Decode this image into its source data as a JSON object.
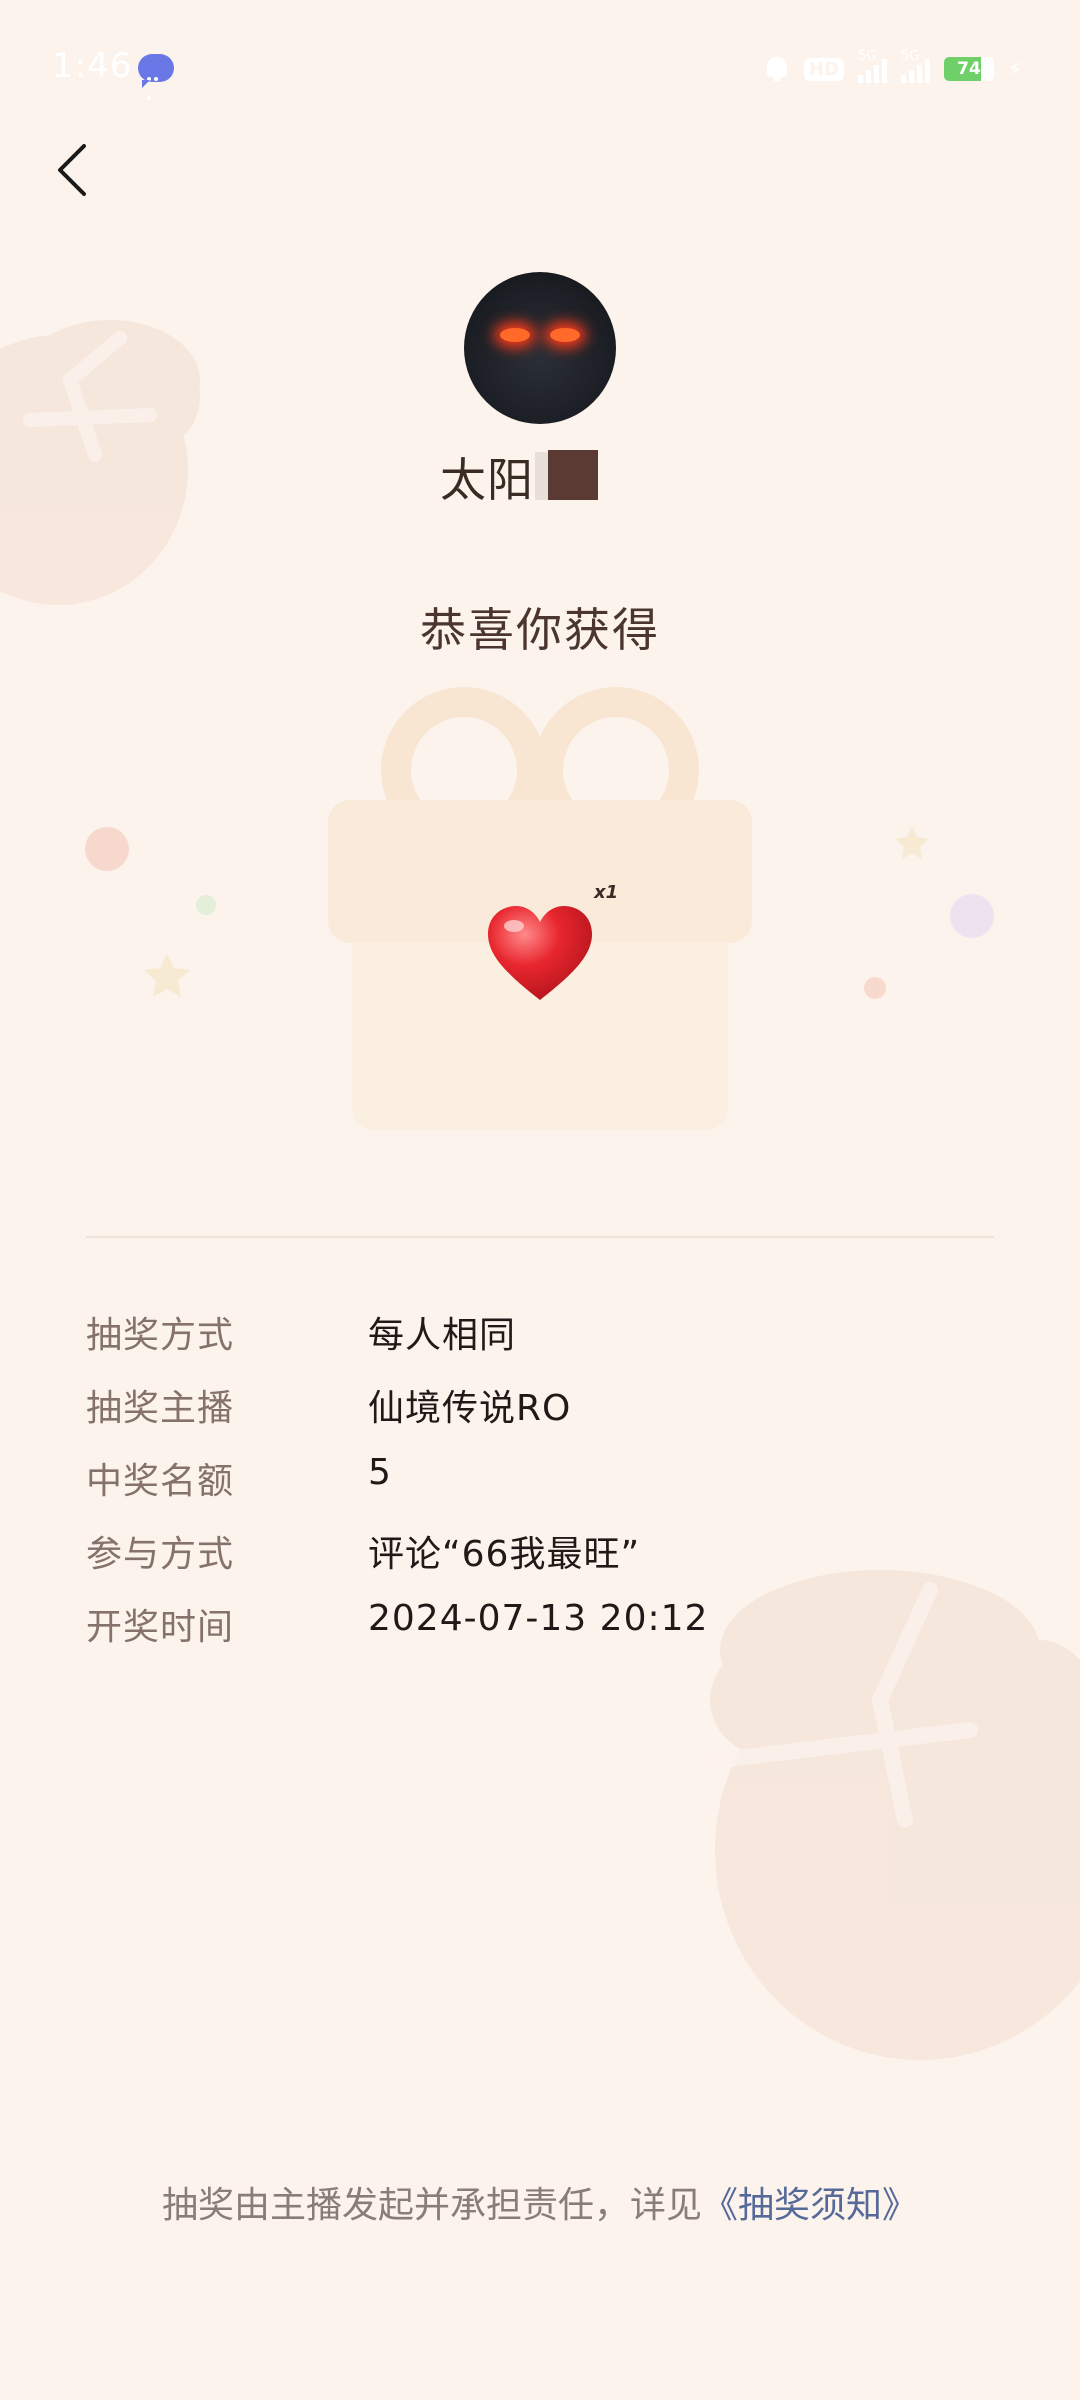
{
  "status_bar": {
    "time": "1:46",
    "hd_label": "HD",
    "network_1": "5G",
    "network_2": "5G",
    "battery": "74"
  },
  "profile": {
    "user_name": "太阳"
  },
  "main": {
    "congrats_title": "恭喜你获得",
    "prize_quantity": "x1",
    "prize_icon": "heart-icon"
  },
  "details": [
    {
      "label": "抽奖方式",
      "value": "每人相同"
    },
    {
      "label": "抽奖主播",
      "value": "仙境传说RO"
    },
    {
      "label": "中奖名额",
      "value": "5"
    },
    {
      "label": "参与方式",
      "value": "评论“66我最旺”"
    },
    {
      "label": "开奖时间",
      "value": "2024-07-13 20:12"
    }
  ],
  "footer": {
    "note": "抽奖由主播发起并承担责任，详见",
    "link_text": "《抽奖须知》"
  },
  "colors": {
    "background": "#fcf3ec",
    "link": "#566a9a",
    "label": "#85726b",
    "value": "#1f1a18"
  }
}
